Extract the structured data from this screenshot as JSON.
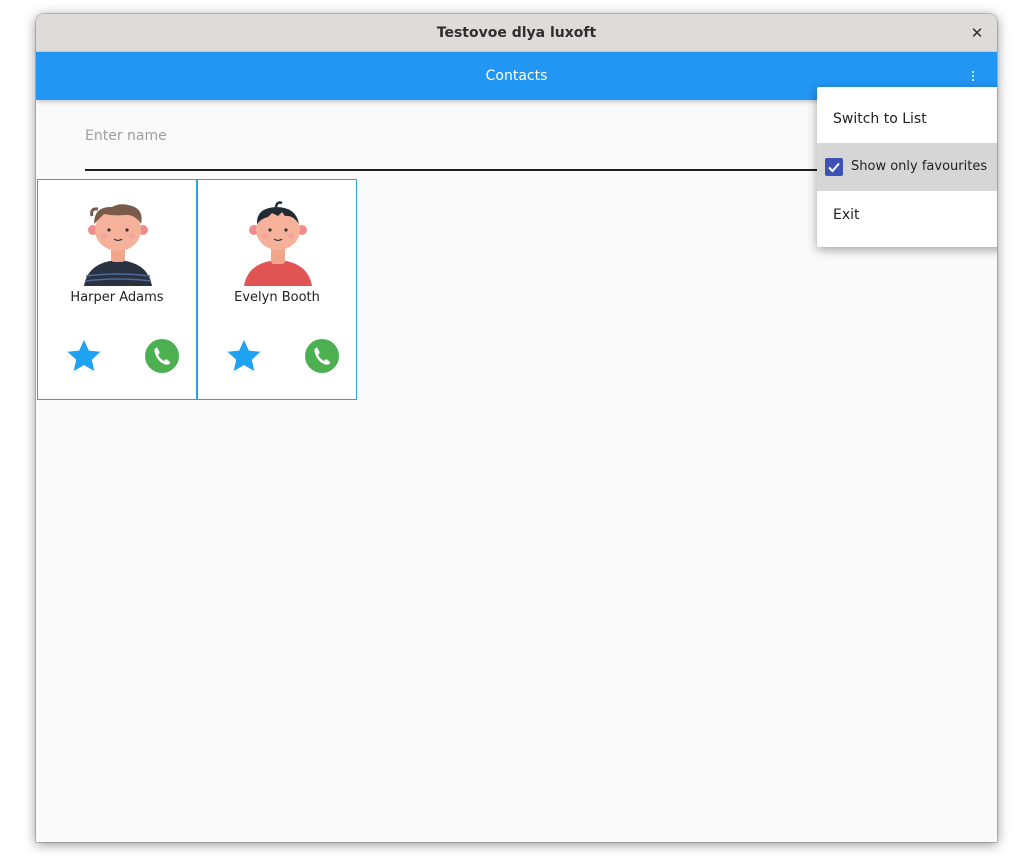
{
  "window": {
    "title": "Testovoe dlya luxoft",
    "close_glyph": "✕"
  },
  "appbar": {
    "title": "Contacts",
    "menu_icon": "more-vertical-icon",
    "color": "#2196f3"
  },
  "search": {
    "placeholder": "Enter name",
    "value": ""
  },
  "contacts": [
    {
      "name": "Harper Adams",
      "avatar_icon": "boy-avatar-brown-hair-icon",
      "favourite": true,
      "shirt_color": "#2a3140"
    },
    {
      "name": "Evelyn Booth",
      "avatar_icon": "boy-avatar-black-hair-icon",
      "favourite": true,
      "shirt_color": "#e05454"
    }
  ],
  "menu": {
    "items": [
      {
        "label": "Switch to List"
      },
      {
        "label": "Show only favourites",
        "checked": true
      },
      {
        "label": "Exit"
      }
    ]
  },
  "colors": {
    "card_border": "#29a3e6",
    "favourite_star": "#1da1f2",
    "call_button": "#4caf50",
    "checkbox": "#3f51b5"
  }
}
